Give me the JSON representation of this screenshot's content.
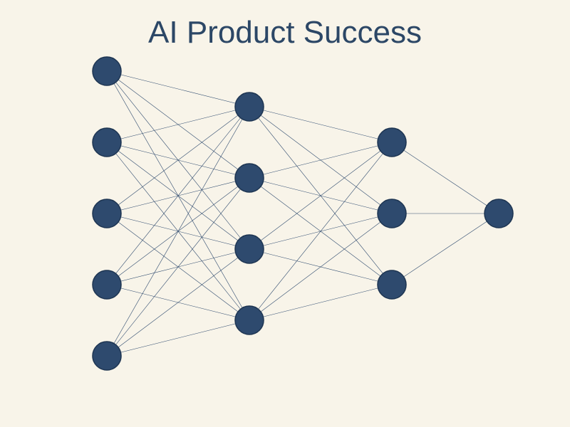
{
  "title": "AI Product Success",
  "colors": {
    "background": "#f8f4e9",
    "node_fill": "#2e4a6e",
    "node_stroke": "#1e3552",
    "edge": "#2e4a6e",
    "title": "#2c4766"
  },
  "network": {
    "layers": [
      5,
      4,
      3,
      1
    ],
    "fully_connected": true
  }
}
